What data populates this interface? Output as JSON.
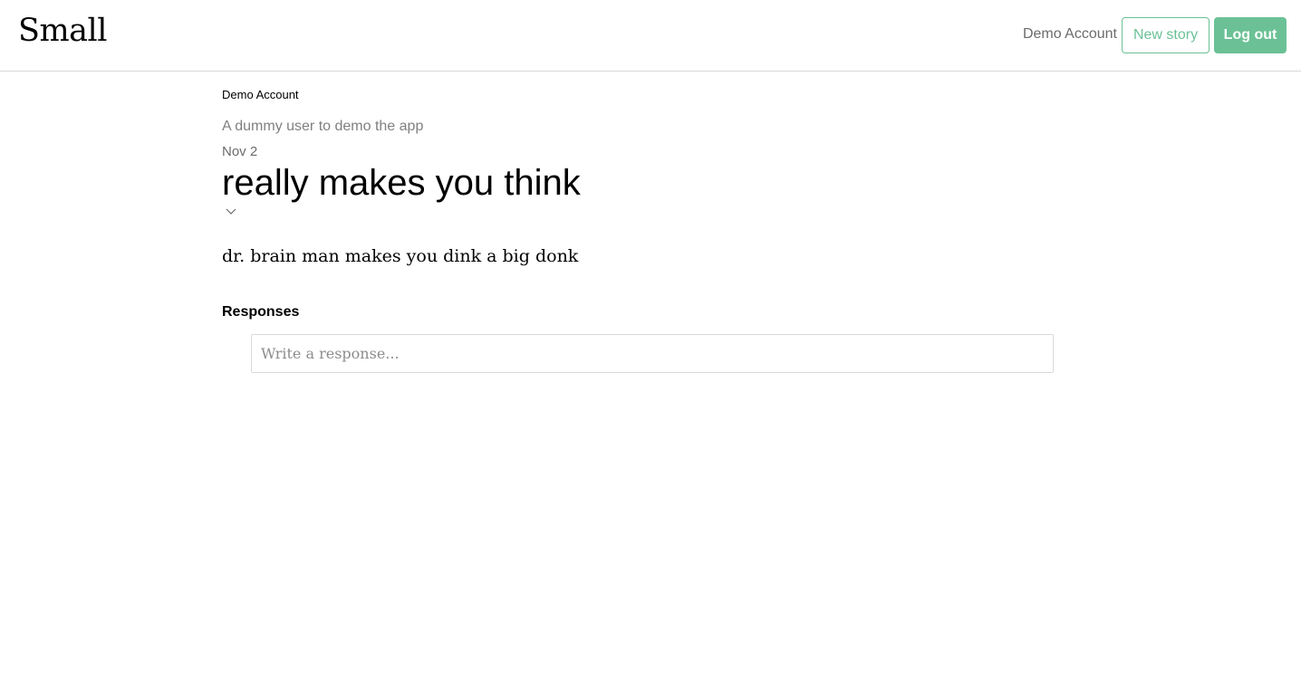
{
  "header": {
    "logo": "Small",
    "user_name": "Demo Account",
    "new_story_label": "New story",
    "logout_label": "Log out"
  },
  "story": {
    "author_name": "Demo Account",
    "author_bio": "A dummy user to demo the app",
    "date": "Nov 2",
    "title": "really makes you think",
    "body": "dr. brain man makes you dink a big donk",
    "menu_icon": "chevron-down-icon"
  },
  "responses": {
    "heading": "Responses",
    "placeholder": "Write a response..."
  },
  "colors": {
    "accent": "#6bc195",
    "border": "#d9d9d9",
    "muted_text": "#808080"
  }
}
